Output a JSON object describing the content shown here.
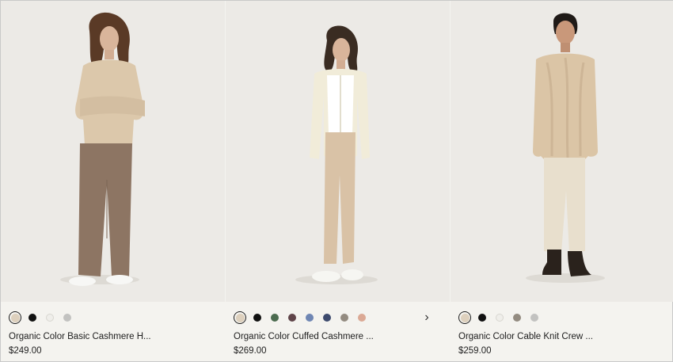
{
  "products": [
    {
      "name": "Organic Color Basic Cashmere H...",
      "price": "$249.00",
      "swatches": [
        {
          "color": "#ddd0bd",
          "selected": true
        },
        {
          "color": "#111111",
          "selected": false
        },
        {
          "color": "#efeeea",
          "selected": false
        },
        {
          "color": "#c2c2c0",
          "selected": false
        }
      ],
      "has_next": false
    },
    {
      "name": "Organic Color Cuffed Cashmere ...",
      "price": "$269.00",
      "swatches": [
        {
          "color": "#ddd0bd",
          "selected": true
        },
        {
          "color": "#111111",
          "selected": false
        },
        {
          "color": "#4b6b4f",
          "selected": false
        },
        {
          "color": "#5f4449",
          "selected": false
        },
        {
          "color": "#6f86b3",
          "selected": false
        },
        {
          "color": "#3d4a6d",
          "selected": false
        },
        {
          "color": "#938b80",
          "selected": false
        },
        {
          "color": "#dba995",
          "selected": false
        }
      ],
      "has_next": true
    },
    {
      "name": "Organic Color Cable Knit Crew ...",
      "price": "$259.00",
      "swatches": [
        {
          "color": "#ddd0bd",
          "selected": true
        },
        {
          "color": "#111111",
          "selected": false
        },
        {
          "color": "#efeeea",
          "selected": false
        },
        {
          "color": "#938b80",
          "selected": false
        },
        {
          "color": "#c2c2c0",
          "selected": false
        }
      ],
      "has_next": false
    }
  ],
  "icons": {
    "next": "chevron-right-icon"
  },
  "next_glyph": "›"
}
